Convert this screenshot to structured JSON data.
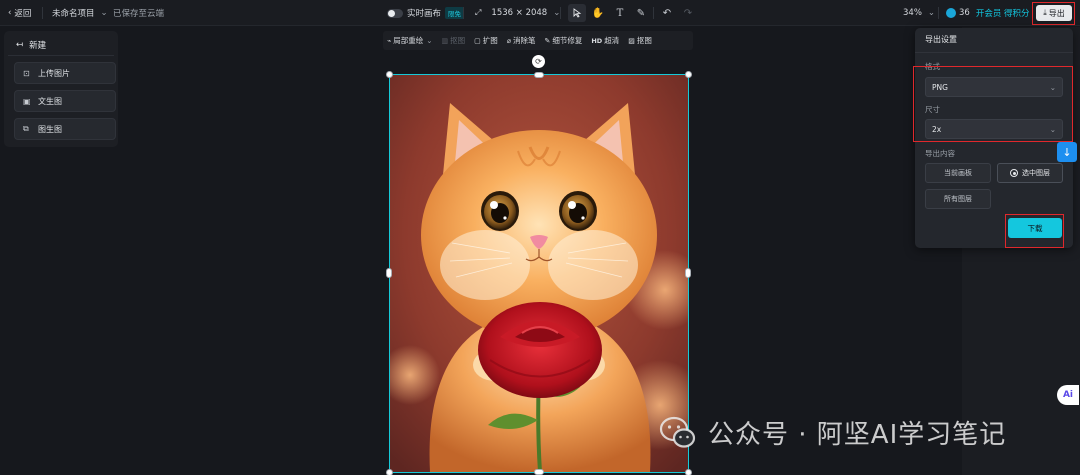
{
  "topbar": {
    "back_label": "返回",
    "project_name": "未命名项目",
    "save_status": "已保存至云端",
    "realtime_label": "实时画布",
    "beta_badge": "限免",
    "canvas_size": "1536 × 2048",
    "zoom": "34%",
    "credits": "36",
    "vip_text": "开会员 得积分",
    "export_label": "导出"
  },
  "left_panel": {
    "new_label": "新建",
    "items": [
      {
        "label": "上传图片",
        "icon": "upload-image-icon"
      },
      {
        "label": "文生图",
        "icon": "text-to-image-icon"
      },
      {
        "label": "图生图",
        "icon": "image-to-image-icon"
      }
    ]
  },
  "canvas_tools": {
    "items": [
      {
        "label": "局部重绘",
        "icon": "brush-icon",
        "enabled": true,
        "has_dropdown": true
      },
      {
        "label": "抠图",
        "icon": "cutout-icon",
        "enabled": false
      },
      {
        "label": "扩图",
        "icon": "expand-icon",
        "enabled": true
      },
      {
        "label": "消除笔",
        "icon": "eraser-icon",
        "enabled": true
      },
      {
        "label": "细节修复",
        "icon": "repair-icon",
        "enabled": true
      },
      {
        "label": "超清",
        "icon": "hd-icon",
        "prefix": "HD",
        "enabled": true
      },
      {
        "label": "抠图",
        "icon": "matting-icon",
        "enabled": true
      }
    ]
  },
  "export_panel": {
    "title": "导出设置",
    "format_label": "格式",
    "format_value": "PNG",
    "size_label": "尺寸",
    "size_value": "2x",
    "content_label": "导出内容",
    "options": [
      {
        "label": "当前画板",
        "selected": false
      },
      {
        "label": "选中图层",
        "selected": true
      },
      {
        "label": "所有图层",
        "selected": false
      }
    ],
    "download_label": "下载"
  },
  "watermark": {
    "text": "公众号 · 阿坚AI学习笔记"
  },
  "colors": {
    "accent": "#14c7de",
    "highlight": "#e0282c",
    "background": "#16181d"
  }
}
